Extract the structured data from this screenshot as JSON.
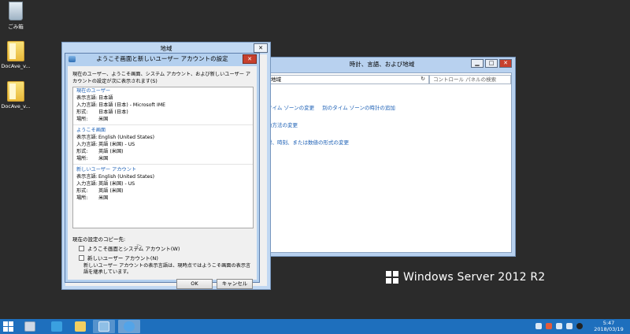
{
  "desktop": {
    "icons": [
      {
        "label": "ごみ箱"
      },
      {
        "label": "DocAve_v..."
      },
      {
        "label": "DocAve_v..."
      }
    ]
  },
  "control_panel": {
    "title": "時計、言語、および地域",
    "address": "地域",
    "refresh_glyph": "↻",
    "search_placeholder": "コントロール パネルの検索",
    "links": [
      [
        "タイム ゾーンの変更",
        "別のタイム ゾーンの時計の追加"
      ],
      [
        "力方法の変更"
      ],
      [
        "付、時刻、または数値の形式の変更"
      ]
    ]
  },
  "region_window": {
    "title": "地域",
    "close_glyph": "✕"
  },
  "dialog": {
    "title": "ようこそ画面と新しいユーザー アカウントの設定",
    "close_glyph": "✕",
    "description": "現在のユーザー、ようこそ画面、システム アカウント、および新しいユーザー アカウントの設定が次に表示されます(S)",
    "sections": [
      {
        "heading": "現在のユーザー",
        "rows": [
          {
            "key": "表示言語:",
            "value": "日本語"
          },
          {
            "key": "入力言語:",
            "value": "日本語 (日本) - Microsoft IME"
          },
          {
            "key": "形式:",
            "value": "日本語 (日本)"
          },
          {
            "key": "場所:",
            "value": "米国"
          }
        ]
      },
      {
        "heading": "ようこそ画面",
        "rows": [
          {
            "key": "表示言語:",
            "value": "English (United States)"
          },
          {
            "key": "入力言語:",
            "value": "英語 (米国) - US"
          },
          {
            "key": "形式:",
            "value": "英語 (米国)"
          },
          {
            "key": "場所:",
            "value": "米国"
          }
        ]
      },
      {
        "heading": "新しいユーザー アカウント",
        "rows": [
          {
            "key": "表示言語:",
            "value": "English (United States)"
          },
          {
            "key": "入力言語:",
            "value": "英語 (米国) - US"
          },
          {
            "key": "形式:",
            "value": "英語 (米国)"
          },
          {
            "key": "場所:",
            "value": "米国"
          }
        ]
      }
    ],
    "copy_heading": "現在の設定のコピー先:",
    "checkbox_welcome": "ようこそ画面とシステム アカウント(W)",
    "checkbox_new_user": "新しいユーザー アカウント(N)",
    "note": "新しいユーザー アカウントの表示言語は、現時点ではようこそ画面の表示言語を継承しています。",
    "ok_label": "OK",
    "cancel_label": "キャンセル"
  },
  "branding": {
    "text": "Windows Server 2012 R2"
  },
  "taskbar": {
    "time": "5:47",
    "date": "2018/03/19"
  }
}
